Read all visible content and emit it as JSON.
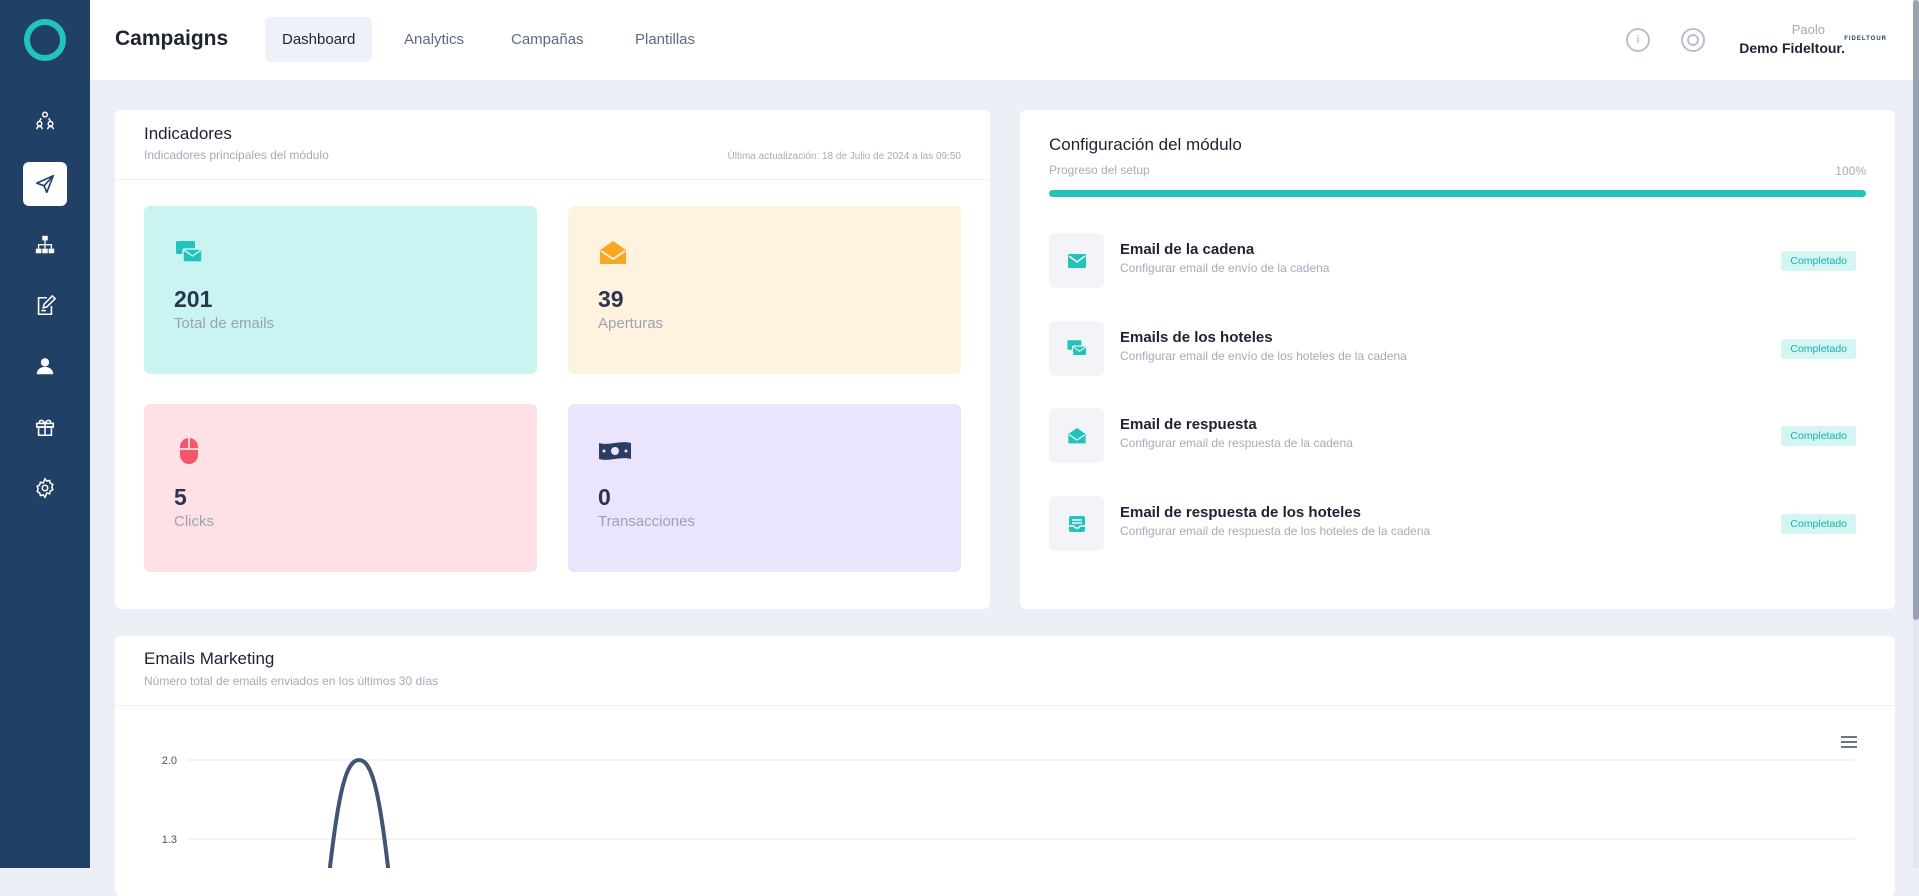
{
  "sidebar": {
    "items": [
      {
        "icon": "users-network-icon",
        "active": false
      },
      {
        "icon": "paper-plane-icon",
        "active": true
      },
      {
        "icon": "sitemap-icon",
        "active": false
      },
      {
        "icon": "edit-document-icon",
        "active": false
      },
      {
        "icon": "user-icon",
        "active": false
      },
      {
        "icon": "gift-icon",
        "active": false
      },
      {
        "icon": "gear-icon",
        "active": false
      }
    ]
  },
  "header": {
    "title": "Campaigns",
    "tabs": [
      {
        "label": "Dashboard",
        "active": true
      },
      {
        "label": "Analytics",
        "active": false
      },
      {
        "label": "Campañas",
        "active": false
      },
      {
        "label": "Plantillas",
        "active": false
      }
    ],
    "icons": [
      "info-icon",
      "lifebuoy-icon"
    ],
    "user": {
      "role": "Paolo",
      "name": "Demo Fideltour.",
      "brand": "FIDELTOUR"
    }
  },
  "indicators": {
    "title": "Indicadores",
    "subtitle": "Indicadores principales del módulo",
    "updated": "Última actualización: 18 de Julio de 2024 a las 09:50",
    "stats": [
      {
        "value": "201",
        "label": "Total de emails",
        "icon": "emails-icon",
        "bg": "#c9f4f2",
        "icon_color": "#22c3bb"
      },
      {
        "value": "39",
        "label": "Aperturas",
        "icon": "open-envelope-icon",
        "bg": "#fff3e0",
        "icon_color": "#f9a825"
      },
      {
        "value": "5",
        "label": "Clicks",
        "icon": "mouse-icon",
        "bg": "#ffe1e5",
        "icon_color": "#f4566b"
      },
      {
        "value": "0",
        "label": "Transacciones",
        "icon": "money-icon",
        "bg": "#ebe4fd",
        "icon_color": "#2b3d63"
      }
    ]
  },
  "setup": {
    "title": "Configuración del módulo",
    "progress_label": "Progreso del setup",
    "progress_text": "100%",
    "progress": 1.0,
    "accent": "#22c3bb",
    "items": [
      {
        "title": "Email de la cadena",
        "desc": "Configurar email de envío de la cadena",
        "status": "Completado",
        "icon": "envelope-icon"
      },
      {
        "title": "Emails de los hoteles",
        "desc": "Configurar email de envío de los hoteles de la cadena",
        "status": "Completado",
        "icon": "emails-icon"
      },
      {
        "title": "Email de respuesta",
        "desc": "Configurar email de respuesta de la cadena",
        "status": "Completado",
        "icon": "open-envelope-icon"
      },
      {
        "title": "Email de respuesta de los hoteles",
        "desc": "Configurar email de respuesta de los hoteles de la cadena",
        "status": "Completado",
        "icon": "inbox-icon"
      }
    ]
  },
  "marketing": {
    "title": "Emails Marketing",
    "subtitle": "Número total de emails enviados en los últimos 30 días",
    "menu_icon": "hamburger-menu-icon"
  },
  "chart_data": {
    "type": "line",
    "title": "",
    "xlabel": "",
    "ylabel": "",
    "y_ticks": [
      "2.0",
      "1.3"
    ],
    "series": [
      {
        "values": [
          0,
          0,
          0,
          2,
          0
        ]
      }
    ],
    "ylim": [
      0,
      2
    ],
    "grid": true,
    "line_color": "#3f5573"
  }
}
